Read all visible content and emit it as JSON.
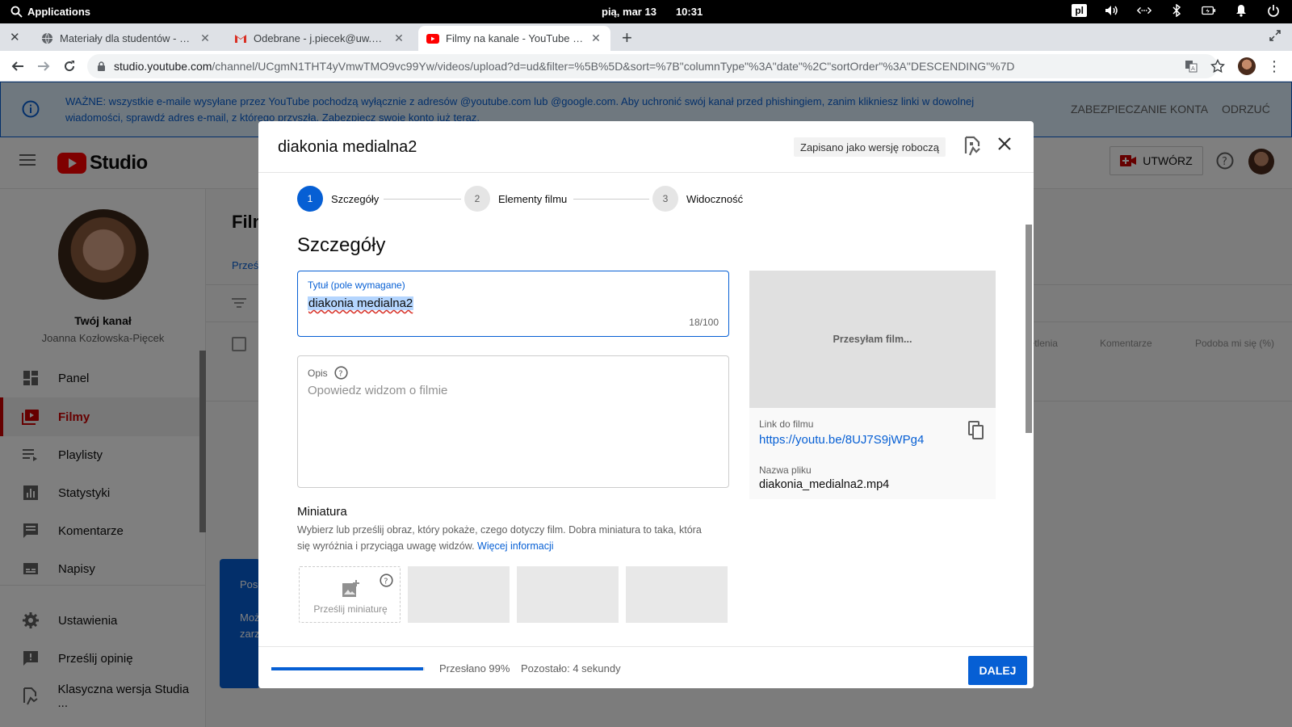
{
  "system": {
    "apps_label": "Applications",
    "date": "pią, mar 13",
    "time": "10:31",
    "lang": "pl"
  },
  "browser": {
    "tabs": [
      {
        "title": "Materiały dla studentów - Jan K",
        "icon": "site-globe-icon",
        "active": false
      },
      {
        "title": "Odebrane - j.piecek@uw.edu.pl",
        "icon": "gmail-icon",
        "active": false
      },
      {
        "title": "Filmy na kanale - YouTube Studio",
        "icon": "youtube-icon",
        "active": true
      }
    ],
    "url_host": "studio.youtube.com",
    "url_path": "/channel/UCgmN1THT4yVmwTMO9vc99Yw/videos/upload?d=ud&filter=%5B%5D&sort=%7B\"columnType\"%3A\"date\"%2C\"sortOrder\"%3A\"DESCENDING\"%7D"
  },
  "banner": {
    "message": "WAŻNE: wszystkie e-maile wysyłane przez YouTube pochodzą wyłącznie z adresów @youtube.com lub @google.com. Aby uchronić swój kanał przed phishingiem, zanim klikniesz linki w dowolnej wiadomości, sprawdź adres e-mail, z którego przyszła. Zabezpiecz swoje konto już teraz.",
    "secure_label": "ZABEZPIECZANIE KONTA",
    "dismiss_label": "ODRZUĆ"
  },
  "studio": {
    "logo_text": "Studio",
    "create_label": "UTWÓRZ",
    "brand_color": "#ff0000"
  },
  "sidebar": {
    "channel_title": "Twój kanał",
    "channel_name": "Joanna Kozłowska-Pięcek",
    "items": [
      {
        "label": "Panel",
        "icon": "dashboard-icon"
      },
      {
        "label": "Filmy",
        "icon": "videos-icon",
        "active": true
      },
      {
        "label": "Playlisty",
        "icon": "playlist-icon"
      },
      {
        "label": "Statystyki",
        "icon": "analytics-icon"
      },
      {
        "label": "Komentarze",
        "icon": "comments-icon"
      },
      {
        "label": "Napisy",
        "icon": "subtitles-icon"
      },
      {
        "label": "Ustawienia",
        "icon": "settings-icon"
      },
      {
        "label": "Prześlij opinię",
        "icon": "feedback-icon"
      },
      {
        "label": "Klasyczna wersja Studia ...",
        "icon": "classic-studio-icon"
      }
    ]
  },
  "background": {
    "page_title": "Filmy",
    "tab": "Prześlij",
    "col_views": "Wyświetlenia",
    "col_comments": "Komentarze",
    "col_likes": "Podoba mi się (%)",
    "popup_title": "Pos",
    "popup_line1": "Moż",
    "popup_line2": "zarz"
  },
  "dialog": {
    "title": "diakonia medialna2",
    "draft_status": "Zapisano jako wersję roboczą",
    "steps": [
      {
        "num": "1",
        "label": "Szczegóły",
        "active": true
      },
      {
        "num": "2",
        "label": "Elementy filmu",
        "active": false
      },
      {
        "num": "3",
        "label": "Widoczność",
        "active": false
      }
    ],
    "section_heading": "Szczegóły",
    "title_field": {
      "label": "Tytuł (pole wymagane)",
      "value": "diakonia medialna2",
      "counter": "18/100"
    },
    "description_field": {
      "label": "Opis",
      "placeholder": "Opowiedz widzom o filmie"
    },
    "thumbnail": {
      "heading": "Miniatura",
      "description": "Wybierz lub prześlij obraz, który pokaże, czego dotyczy film. Dobra miniatura to taka, która się wyróżnia i przyciąga uwagę widzów.",
      "more_link": "Więcej informacji",
      "upload_label": "Prześlij miniaturę"
    },
    "preview": {
      "status": "Przesyłam film...",
      "link_label": "Link do filmu",
      "link": "https://youtu.be/8UJ7S9jWPg4",
      "file_label": "Nazwa pliku",
      "file_name": "diakonia_medialna2.mp4"
    },
    "footer": {
      "progress": 0.99,
      "uploaded": "Przesłano 99%",
      "remaining": "Pozostało: 4 sekundy",
      "next_label": "DALEJ"
    }
  }
}
